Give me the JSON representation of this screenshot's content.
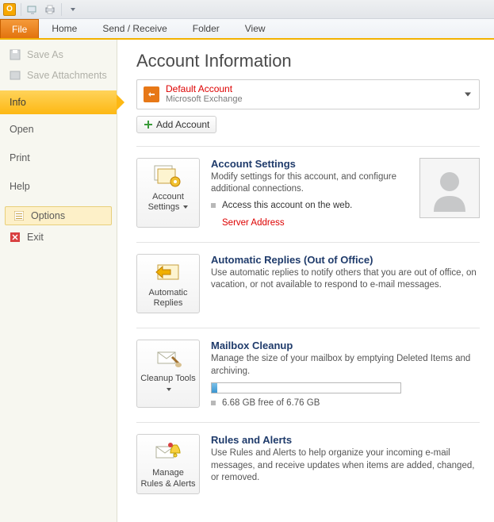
{
  "titlebar": {
    "app_icon_letter": "O"
  },
  "ribbon": {
    "tabs": [
      "File",
      "Home",
      "Send / Receive",
      "Folder",
      "View"
    ]
  },
  "leftnav": {
    "save_as": "Save As",
    "save_attachments": "Save Attachments",
    "info": "Info",
    "open": "Open",
    "print": "Print",
    "help": "Help",
    "options": "Options",
    "exit": "Exit"
  },
  "main": {
    "heading": "Account Information",
    "account": {
      "name": "Default Account",
      "type": "Microsoft Exchange"
    },
    "add_account": "Add Account",
    "sections": {
      "account_settings": {
        "btn_label": "Account Settings",
        "title": "Account Settings",
        "desc": "Modify settings for this account, and configure additional connections.",
        "bullet": "Access this account on the web.",
        "server": "Server Address"
      },
      "auto_replies": {
        "btn_label": "Automatic Replies",
        "title": "Automatic Replies (Out of Office)",
        "desc": "Use automatic replies to notify others that you are out of office, on vacation, or not available to respond to e-mail messages."
      },
      "cleanup": {
        "btn_label": "Cleanup Tools",
        "title": "Mailbox Cleanup",
        "desc": "Manage the size of your mailbox by emptying Deleted Items and archiving.",
        "storage": "6.68 GB free of 6.76 GB"
      },
      "rules": {
        "btn_label": "Manage Rules & Alerts",
        "title": "Rules and Alerts",
        "desc": "Use Rules and Alerts to help organize your incoming e-mail messages, and receive updates when items are added, changed, or removed."
      }
    }
  }
}
